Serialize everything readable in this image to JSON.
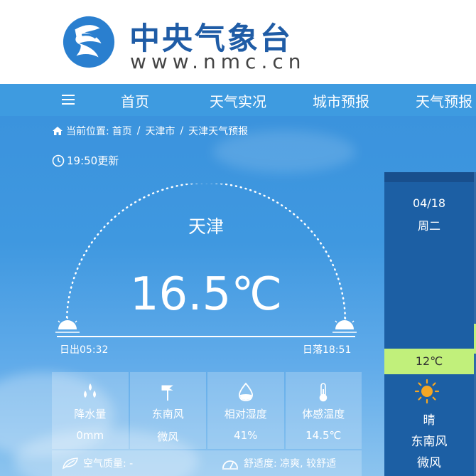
{
  "header": {
    "logo_title": "中央气象台",
    "logo_url": "www.nmc.cn"
  },
  "nav": {
    "items": [
      "首页",
      "天气实况",
      "城市预报",
      "天气预报"
    ]
  },
  "breadcrumb": {
    "prefix": "当前位置:",
    "items": [
      "首页",
      "天津市",
      "天津天气预报"
    ]
  },
  "update_time": "19:50更新",
  "current": {
    "city": "天津",
    "temperature": "16.5℃",
    "sunrise": "日出05:32",
    "sunset": "日落18:51"
  },
  "cards": [
    {
      "icon": "raindrops-icon",
      "label": "降水量",
      "value": "0mm"
    },
    {
      "icon": "wind-vane-icon",
      "label": "东南风",
      "value": "微风"
    },
    {
      "icon": "humidity-drop-icon",
      "label": "相对湿度",
      "value": "41%"
    },
    {
      "icon": "thermometer-icon",
      "label": "体感温度",
      "value": "14.5℃"
    }
  ],
  "bottom": {
    "air_quality": "空气质量: -",
    "comfort": "舒适度: 凉爽, 较舒适"
  },
  "forecast": {
    "date": "04/18",
    "weekday": "周二",
    "temperature": "12℃",
    "condition": "晴",
    "wind_direction": "东南风",
    "wind_level": "微风"
  },
  "colors": {
    "brand_blue": "#1f5ca6",
    "nav_blue": "#3e9be0",
    "forecast_bg": "#1c5fa4",
    "temp_highlight": "#c1f07b"
  }
}
